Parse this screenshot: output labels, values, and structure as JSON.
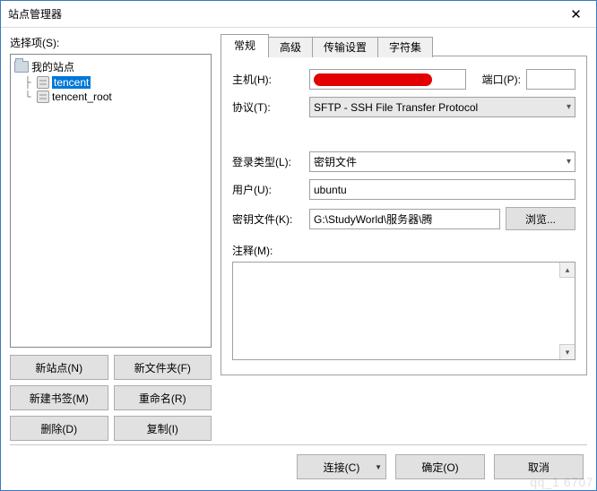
{
  "window": {
    "title": "站点管理器"
  },
  "left": {
    "label": "选择项(S):",
    "root": "我的站点",
    "items": [
      "tencent",
      "tencent_root"
    ],
    "selected_index": 0,
    "buttons": {
      "new_site": "新站点(N)",
      "new_folder": "新文件夹(F)",
      "new_bookmark": "新建书签(M)",
      "rename": "重命名(R)",
      "delete": "删除(D)",
      "copy": "复制(I)"
    }
  },
  "tabs": {
    "items": [
      "常规",
      "高级",
      "传输设置",
      "字符集"
    ],
    "active_index": 0
  },
  "general": {
    "host_label": "主机(H):",
    "host_value": "",
    "port_label": "端口(P):",
    "port_value": "",
    "protocol_label": "协议(T):",
    "protocol_value": "SFTP - SSH File Transfer Protocol",
    "logon_label": "登录类型(L):",
    "logon_value": "密钥文件",
    "user_label": "用户(U):",
    "user_value": "ubuntu",
    "keyfile_label": "密钥文件(K):",
    "keyfile_value": "G:\\StudyWorld\\服务器\\腾",
    "browse_label": "浏览...",
    "comment_label": "注释(M):",
    "comment_value": ""
  },
  "footer": {
    "connect": "连接(C)",
    "ok": "确定(O)",
    "cancel": "取消"
  },
  "watermark": "qq_1   6707"
}
